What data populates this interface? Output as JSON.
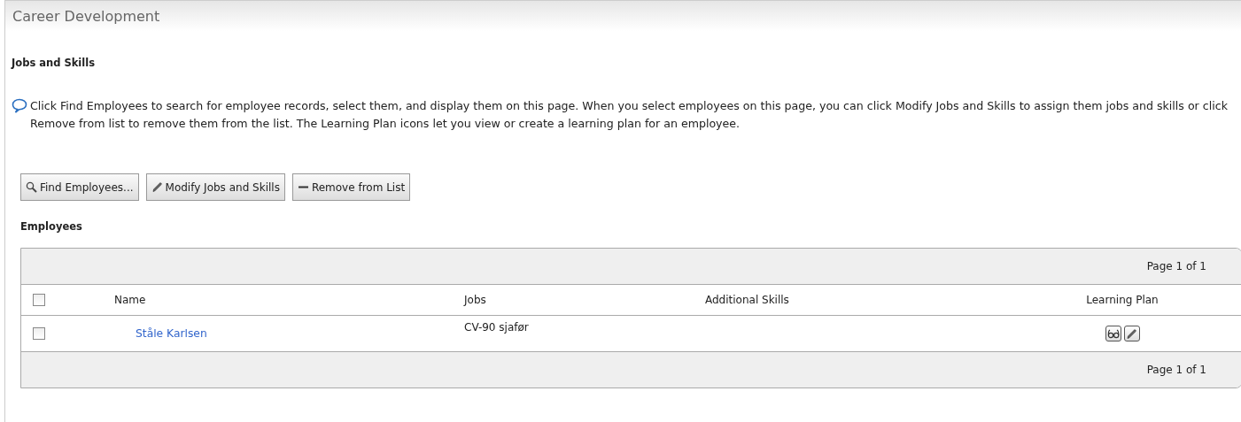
{
  "page_title": "Career Development",
  "section_title": "Jobs and Skills",
  "intro": "Click Find Employees to search for employee records, select them, and display them on this page. When you select employees on this page, you can click Modify Jobs and Skills to assign them jobs and skills or click Remove from list to remove them from the list. The Learning Plan icons let you view or create a learning plan for an employee.",
  "buttons": [
    {
      "label": "Find Employees...",
      "kind": "search"
    },
    {
      "label": "Modify Jobs and Skills",
      "kind": "edit"
    },
    {
      "label": "Remove from List",
      "kind": "remove"
    }
  ],
  "table": {
    "title": "Employees",
    "pager_top": "Page 1 of 1",
    "pager_bottom": "Page 1 of 1",
    "select_all_checked": false,
    "columns": [
      "Name",
      "Jobs",
      "Additional Skills",
      "Learning Plan"
    ],
    "rows": [
      {
        "checked": false,
        "name": "Ståle Karlsen",
        "jobs": "CV-90 sjafør"
      }
    ]
  }
}
